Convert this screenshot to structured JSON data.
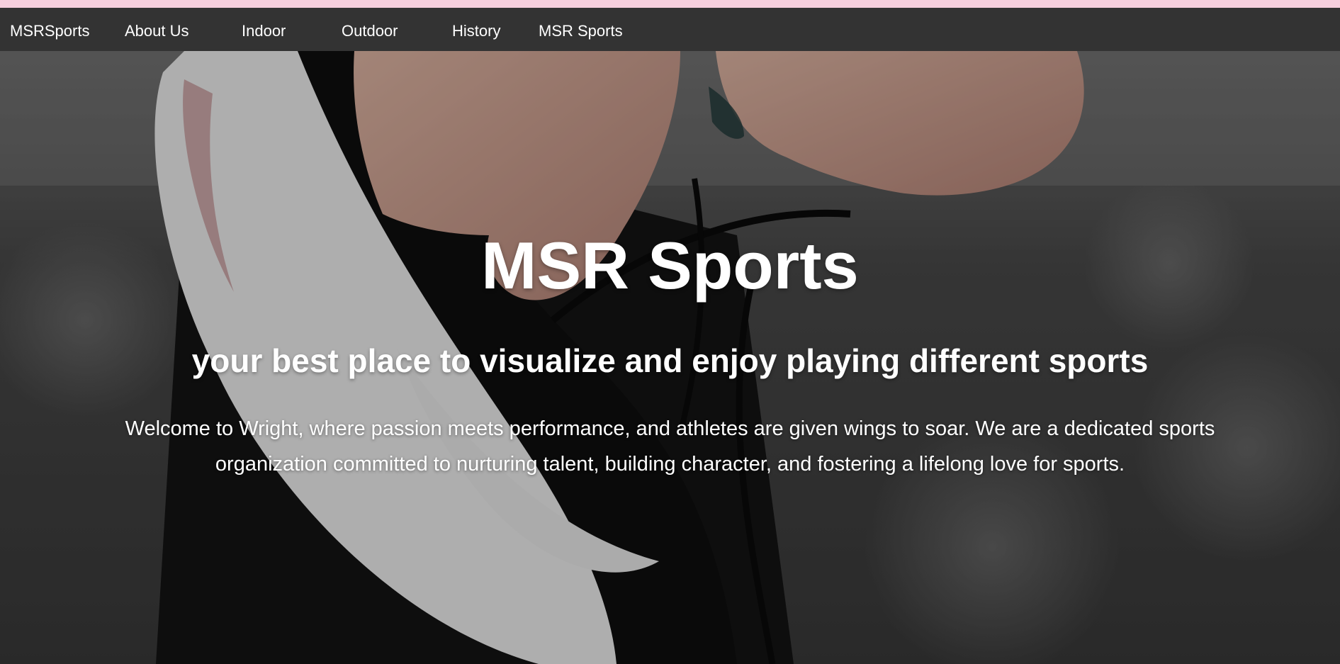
{
  "nav": {
    "brand": "MSRSports",
    "items": [
      {
        "label": "About Us"
      },
      {
        "label": "Indoor"
      },
      {
        "label": "Outdoor"
      },
      {
        "label": "History"
      },
      {
        "label": "MSR Sports"
      }
    ]
  },
  "hero": {
    "title": "MSR Sports",
    "subtitle": "your best place to visualize and enjoy playing different sports",
    "description": "Welcome to Wright, where passion meets performance, and athletes are given wings to soar. We are a dedicated sports organization committed to nurturing talent, building character, and fostering a lifelong love for sports."
  },
  "colors": {
    "top_strip": "#f6cfdd",
    "navbar": "#333333",
    "text": "#ffffff"
  }
}
